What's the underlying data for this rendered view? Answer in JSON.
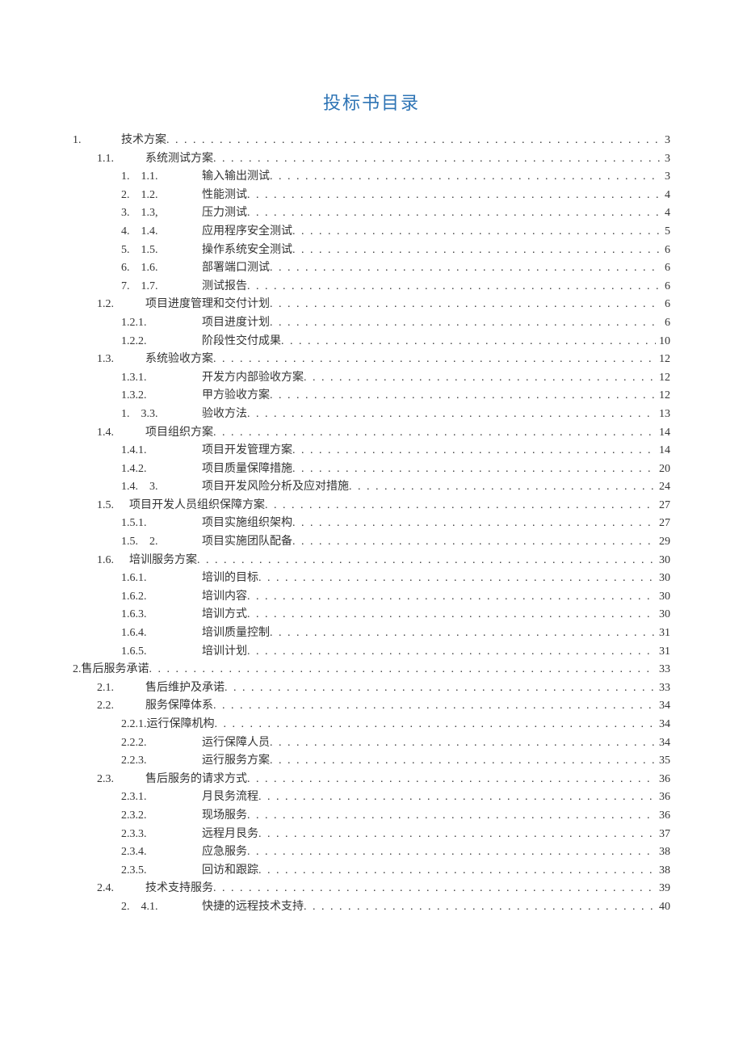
{
  "title": "投标书目录",
  "toc": [
    {
      "level": 1,
      "num": "1.",
      "text": "技术方案",
      "page": "3"
    },
    {
      "level": 2,
      "num": "1.1.",
      "text": "系统测试方案",
      "page": "3"
    },
    {
      "level": 3,
      "num": "1.　1.1.",
      "text": "输入输出测试",
      "page": "3"
    },
    {
      "level": 3,
      "num": "2.　1.2.",
      "text": "性能测试",
      "page": "4"
    },
    {
      "level": 3,
      "num": "3.　1.3,",
      "text": "压力测试",
      "page": "4"
    },
    {
      "level": 3,
      "num": "4.　1.4.",
      "text": "应用程序安全测试",
      "page": "5"
    },
    {
      "level": 3,
      "num": "5.　1.5.",
      "text": "操作系统安全测试",
      "page": "6"
    },
    {
      "level": 3,
      "num": "6.　1.6.",
      "text": "部署端口测试",
      "page": "6"
    },
    {
      "level": 3,
      "num": "7.　1.7.",
      "text": "测试报告",
      "page": "6"
    },
    {
      "level": 2,
      "num": "1.2.",
      "text": "项目进度管理和交付计划",
      "page": "6"
    },
    {
      "level": 3,
      "num": "1.2.1.",
      "text": "项目进度计划",
      "page": "6"
    },
    {
      "level": 3,
      "num": "1.2.2.",
      "text": "阶段性交付成果",
      "page": "10"
    },
    {
      "level": 2,
      "num": "1.3.",
      "text": "系统验收方案",
      "page": "12"
    },
    {
      "level": 3,
      "num": "1.3.1.",
      "text": "开发方内部验收方案",
      "page": "12"
    },
    {
      "level": 3,
      "num": "1.3.2.",
      "text": "甲方验收方案",
      "page": "12"
    },
    {
      "level": 3,
      "num": "1.　3.3.",
      "text": "验收方法",
      "page": "13"
    },
    {
      "level": 2,
      "num": "1.4.",
      "text": "项目组织方案",
      "page": "14"
    },
    {
      "level": 3,
      "num": "1.4.1.",
      "text": "项目开发管理方案",
      "page": "14"
    },
    {
      "level": 3,
      "num": "1.4.2.",
      "text": "项目质量保障措施",
      "page": "20"
    },
    {
      "level": 3,
      "num": "1.4.　3.",
      "text": "项目开发风险分析及应对措施",
      "page": "24"
    },
    {
      "level": 2,
      "num": "1.5.",
      "text": "项目开发人员组织保障方案",
      "nudge": true,
      "page": "27"
    },
    {
      "level": 3,
      "num": "1.5.1.",
      "text": "项目实施组织架构",
      "page": "27"
    },
    {
      "level": 3,
      "num": "1.5.　2.",
      "text": "项目实施团队配备",
      "page": "29"
    },
    {
      "level": 2,
      "num": "1.6.",
      "text": "培训服务方案",
      "nudge": true,
      "page": "30"
    },
    {
      "level": 3,
      "num": "1.6.1.",
      "text": "培训的目标",
      "page": "30"
    },
    {
      "level": 3,
      "num": "1.6.2.",
      "text": "培训内容",
      "page": "30"
    },
    {
      "level": 3,
      "num": "1.6.3.",
      "text": "培训方式",
      "page": "30"
    },
    {
      "level": 3,
      "num": "1.6.4.",
      "text": "培训质量控制",
      "page": "31"
    },
    {
      "level": 3,
      "num": "1.6.5.",
      "text": "培训计划",
      "page": "31"
    },
    {
      "level": 1,
      "num": "2.",
      "text": "售后服务承诺",
      "compact": true,
      "page": "33"
    },
    {
      "level": 2,
      "num": "2.1.",
      "text": "售后维护及承诺 ",
      "page": "33"
    },
    {
      "level": 2,
      "num": "2.2.",
      "text": "服务保障体系 ",
      "page": "34"
    },
    {
      "level": 3,
      "num": "2.2.1.",
      "text": "运行保障机构 ",
      "compact3": true,
      "page": "34"
    },
    {
      "level": 3,
      "num": "2.2.2.",
      "text": "运行保障人员",
      "page": "34"
    },
    {
      "level": 3,
      "num": "2.2.3.",
      "text": "运行服务方案",
      "page": "35"
    },
    {
      "level": 2,
      "num": "2.3.",
      "text": "售后服务的请求方式 ",
      "page": "36"
    },
    {
      "level": 3,
      "num": "2.3.1.",
      "text": "月艮务流程",
      "page": "36"
    },
    {
      "level": 3,
      "num": "2.3.2.",
      "text": "现场服务",
      "page": "36"
    },
    {
      "level": 3,
      "num": "2.3.3.",
      "text": "远程月艮务",
      "page": "37"
    },
    {
      "level": 3,
      "num": "2.3.4.",
      "text": "应急服务",
      "page": "38"
    },
    {
      "level": 3,
      "num": "2.3.5.",
      "text": "回访和跟踪",
      "page": "38"
    },
    {
      "level": 2,
      "num": "2.4.",
      "text": "技术支持服务 ",
      "page": "39"
    },
    {
      "level": 3,
      "num": "2.　4.1.",
      "text": "快捷的远程技术支持",
      "page": "40"
    }
  ]
}
